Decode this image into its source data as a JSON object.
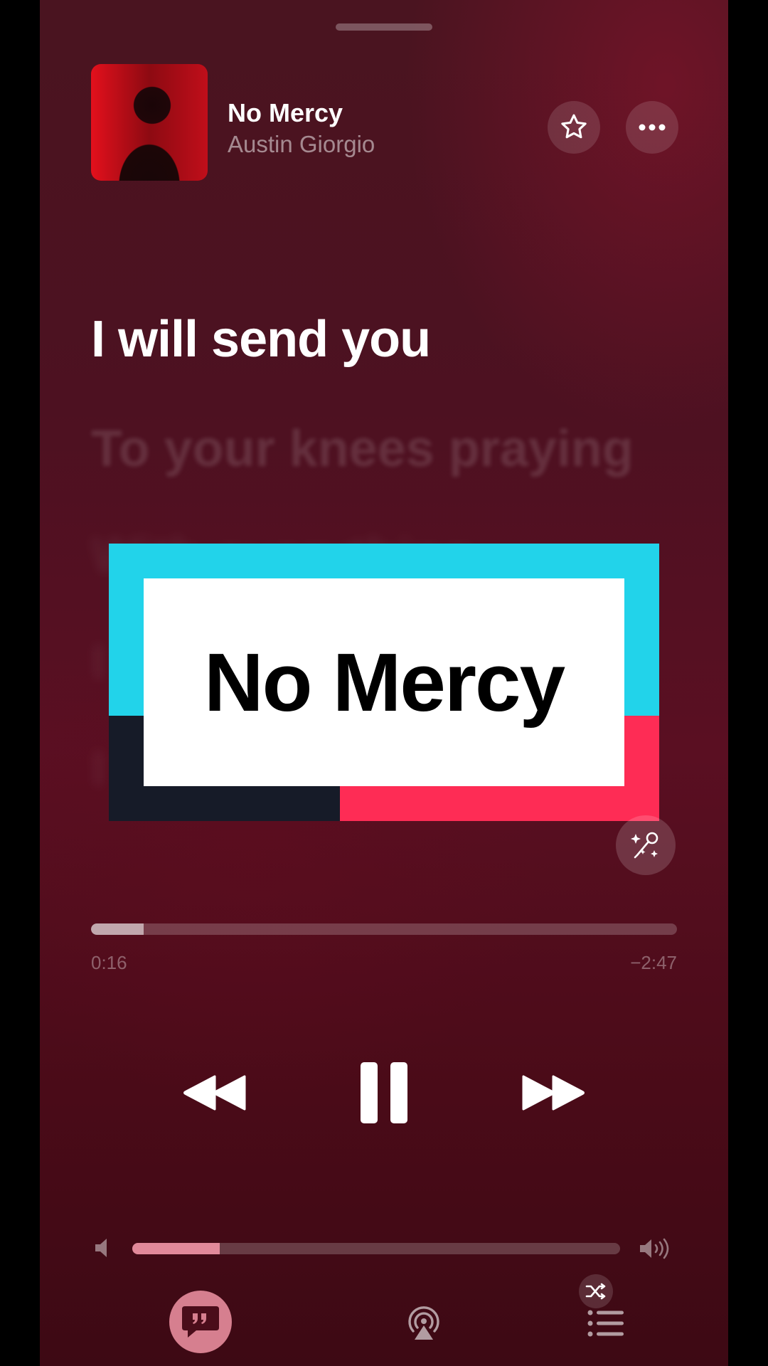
{
  "now_playing": {
    "title": "No Mercy",
    "artist": "Austin Giorgio"
  },
  "lyrics": {
    "current_line": "I will send you",
    "next_line": "To your knees praying",
    "faded_lines": [
      "With everything",
      "I",
      "I",
      ""
    ]
  },
  "overlay": {
    "text": "No Mercy",
    "colors": {
      "cyan": "#22d3ea",
      "pink": "#fe2c55",
      "dark": "#161b28"
    }
  },
  "playback": {
    "elapsed": "0:16",
    "remaining": "−2:47",
    "progress_fraction": 0.09,
    "state": "playing"
  },
  "volume": {
    "level_fraction": 0.18
  },
  "icons": {
    "favorite": "star-icon",
    "more": "ellipsis-icon",
    "sing": "microphone-sparkle-icon",
    "rewind": "rewind-icon",
    "pause": "pause-icon",
    "forward": "fast-forward-icon",
    "volume_low": "speaker-low-icon",
    "volume_high": "speaker-high-icon",
    "lyrics": "quote-bubble-icon",
    "airplay": "airplay-icon",
    "queue": "list-icon",
    "shuffle": "shuffle-icon"
  }
}
